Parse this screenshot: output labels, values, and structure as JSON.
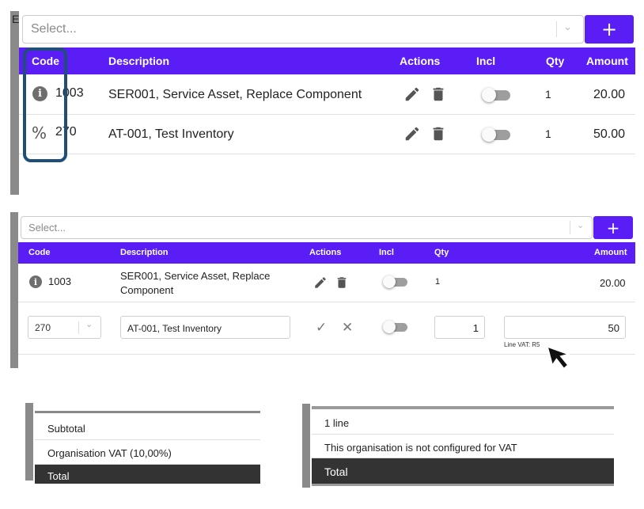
{
  "panel1": {
    "select_placeholder": "Select...",
    "add_label": "+",
    "columns": {
      "code": "Code",
      "description": "Description",
      "actions": "Actions",
      "incl": "Incl",
      "qty": "Qty",
      "amount": "Amount"
    },
    "rows": [
      {
        "icon": "info-icon",
        "code": "1003",
        "description": "SER001, Service Asset, Replace Component",
        "qty": "1",
        "amount": "20.00",
        "incl": false
      },
      {
        "icon": "percent-icon",
        "code": "270",
        "description": "AT-001, Test Inventory",
        "qty": "1",
        "amount": "50.00",
        "incl": false
      }
    ],
    "highlight_color": "#1f4e79",
    "left_edge_letter": "E"
  },
  "panel2": {
    "select_placeholder": "Select...",
    "add_label": "+",
    "columns": {
      "code": "Code",
      "description": "Description",
      "actions": "Actions",
      "incl": "Incl",
      "qty": "Qty",
      "amount": "Amount"
    },
    "row1": {
      "icon": "info-icon",
      "code": "1003",
      "description_line1": "SER001, Service Asset, Replace",
      "description_line2": "Component",
      "qty": "1",
      "amount": "20.00"
    },
    "edit_row": {
      "code_value": "270",
      "description_value": "AT-001, Test Inventory",
      "qty_value": "1",
      "amount_value": "50",
      "vat_note": "Line VAT: R5"
    }
  },
  "totals_left": {
    "subtotal": "Subtotal",
    "vat": "Organisation VAT (10,00%)",
    "total": "Total"
  },
  "totals_right": {
    "lines": "1 line",
    "vat_note": "This organisation is not configured for VAT",
    "total": "Total"
  },
  "colors": {
    "accent": "#5a1df5",
    "dark": "#333333"
  }
}
